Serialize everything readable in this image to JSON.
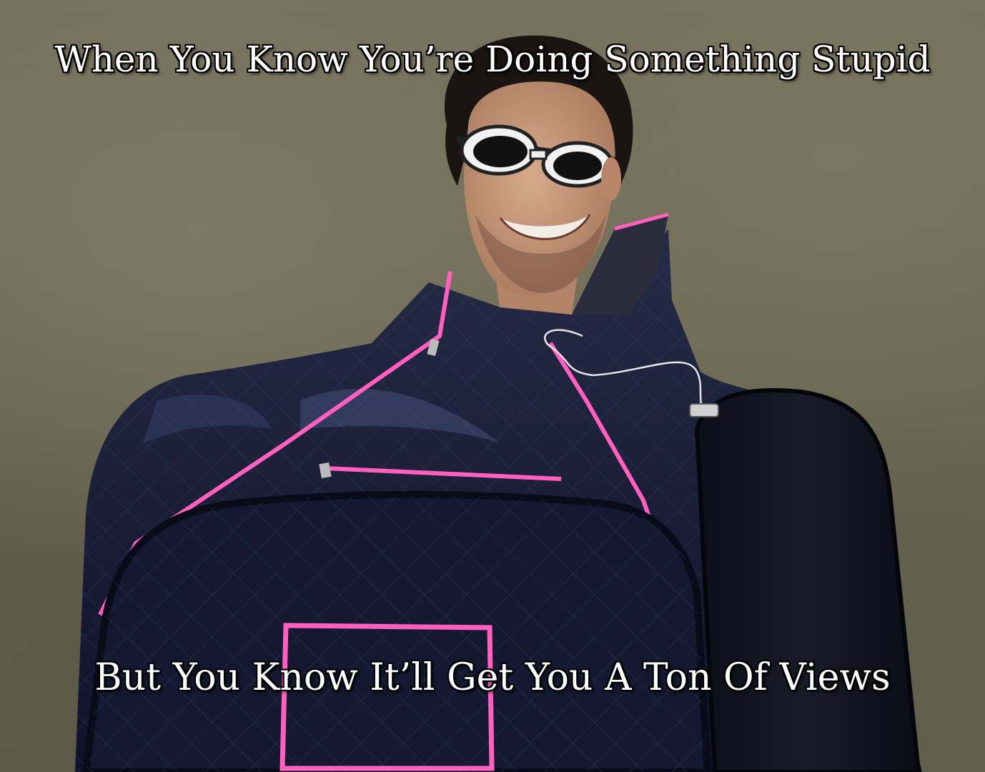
{
  "meme": {
    "top_text": "When You Know You’re Doing Something Stupid",
    "bottom_text": "But You Know It’ll Get You A Ton Of Views"
  },
  "colors": {
    "wall": "#6f6b58",
    "tent": "#1c2038",
    "piping": "#ff5fbf",
    "skin": "#c89a7c",
    "hair": "#1a1512",
    "text": "#ffffff",
    "text_outline": "#000000"
  }
}
